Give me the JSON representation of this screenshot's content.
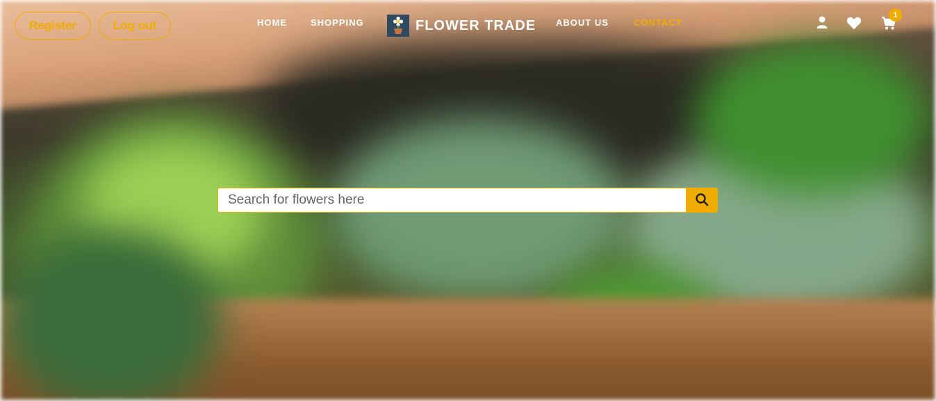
{
  "header": {
    "auth": {
      "register_label": "Register",
      "logout_label": "Log out"
    },
    "nav": {
      "home": "HOME",
      "shopping": "SHOPPING",
      "about": "ABOUT US",
      "contact": "CONTACT"
    },
    "brand": {
      "name": "FLOWER TRADE",
      "logo_icon": "flower-pot-icon"
    },
    "icons": {
      "user": "user-icon",
      "wishlist": "heart-icon",
      "cart": "cart-icon"
    },
    "cart_count": "1"
  },
  "search": {
    "placeholder": "Search for flowers here",
    "button_icon": "search-icon"
  },
  "colors": {
    "accent": "#f0ad00",
    "nav_text": "#ffffff",
    "brand_logo_bg": "#2f4a5e"
  }
}
